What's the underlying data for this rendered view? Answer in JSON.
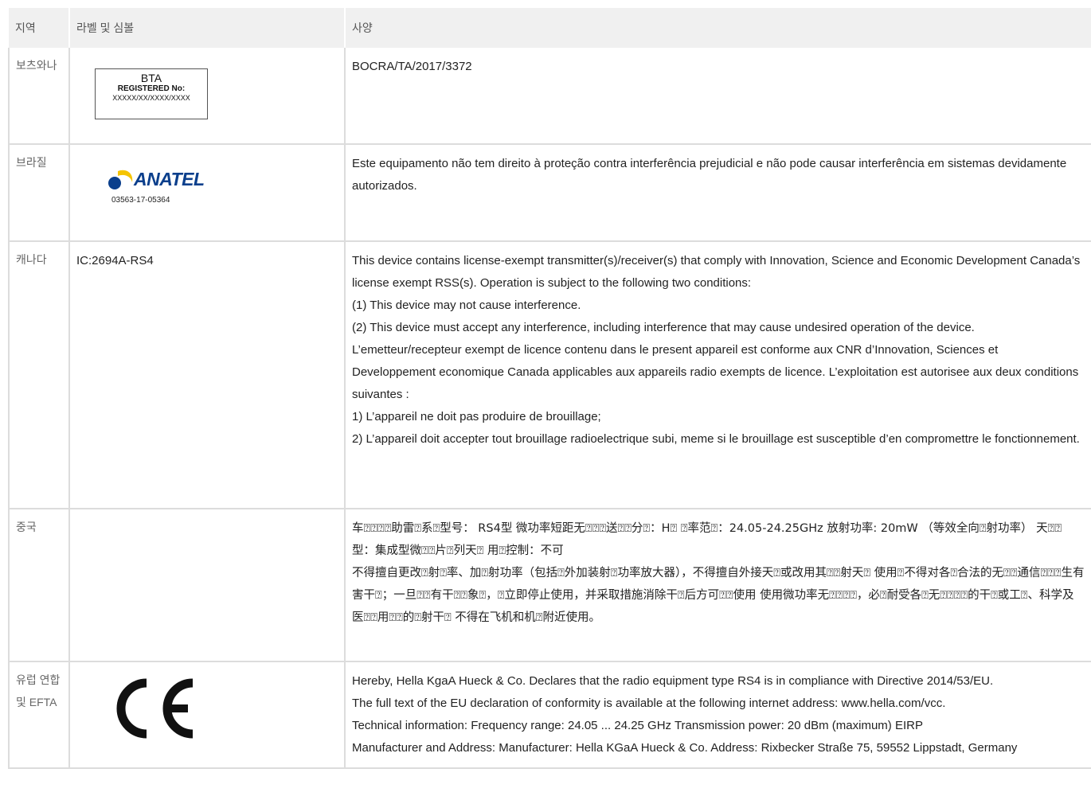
{
  "header": {
    "region": "지역",
    "label": "라벨 및 심볼",
    "spec": "사양"
  },
  "rows": {
    "botswana": {
      "region": "보츠와나",
      "badge_title": "BTA",
      "badge_line2": "REGISTERED No:",
      "badge_line3": "XXXXX/XX/XXXX/XXXX",
      "spec": "BOCRA/TA/2017/3372"
    },
    "brazil": {
      "region": "브라질",
      "logo_text": "ANATEL",
      "logo_number": "03563-17-05364",
      "spec": "Este equipamento não tem direito à proteção contra interferência prejudicial e não pode causar interferência em sistemas devidamente autorizados."
    },
    "canada": {
      "region": "캐나다",
      "label_text": "IC:2694A-RS4",
      "spec_lines": [
        "This device contains license-exempt transmitter(s)/receiver(s) that comply with Innovation, Science and Economic Development Canada’s license exempt RSS(s). Operation is subject to the following two conditions:",
        "(1) This device may not cause interference.",
        "(2) This device must accept any interference, including interference that may cause undesired operation of the device.",
        "L’emetteur/recepteur exempt de licence contenu dans le present appareil est conforme aux CNR d’Innovation, Sciences et Developpement economique Canada applicables aux appareils radio exempts de licence. L’exploitation est autorisee aux deux conditions suivantes :",
        "1) L’appareil ne doit pas produire de brouillage;",
        "2) L’appareil doit accepter tout brouillage radioelectrique subi, meme si le brouillage est susceptible d’en compromettre le fonctionnement."
      ]
    },
    "china": {
      "region": "중국",
      "spec_lines": [
        "车⍰⍰⍰⍰助雷⍰系⍰型号： RS4型 微功率短距无⍰⍰⍰送⍰⍰分⍰：H⍰ ⍰率范⍰：24.05-24.25GHz 放射功率: 20mW （等效全向⍰射功率） 天⍰⍰型：集成型微⍰⍰片⍰列天⍰ 用⍰控制：不可",
        "不得擅自更改⍰射⍰率、加⍰射功率（包括⍰外加装射⍰功率放大器），不得擅自外接天⍰或改用其⍰⍰射天⍰ 使用⍰不得对各⍰合法的无⍰⍰通信⍰⍰⍰生有害干⍰；一旦⍰⍰有干⍰⍰象⍰，⍰立即停止使用，并采取措施消除干⍰后方可⍰⍰使用 使用微功率无⍰⍰⍰⍰，必⍰耐受各⍰无⍰⍰⍰⍰的干⍰或工⍰、科学及医⍰⍰用⍰⍰的⍰射干⍰ 不得在飞机和机⍰附近使用。"
      ]
    },
    "eu": {
      "region": "유럽 연합 및 EFTA",
      "mark_name": "CE",
      "spec_lines": [
        "Hereby, Hella KgaA Hueck & Co. Declares that the radio equipment type RS4 is in compliance with Directive 2014/53/EU.",
        "The full text of the EU declaration of conformity is available at the following internet address: www.hella.com/vcc.",
        "Technical information: Frequency range: 24.05 ... 24.25 GHz Transmission power: 20 dBm (maximum) EIRP",
        "Manufacturer and Address: Manufacturer: Hella KGaA Hueck & Co. Address: Rixbecker Straße 75, 59552 Lippstadt, Germany"
      ]
    }
  },
  "colors": {
    "header_bg": "#f0f0f0",
    "grid": "#dcdcdc",
    "anatel_blue": "#0b3f8c",
    "anatel_yellow": "#f5c400"
  }
}
